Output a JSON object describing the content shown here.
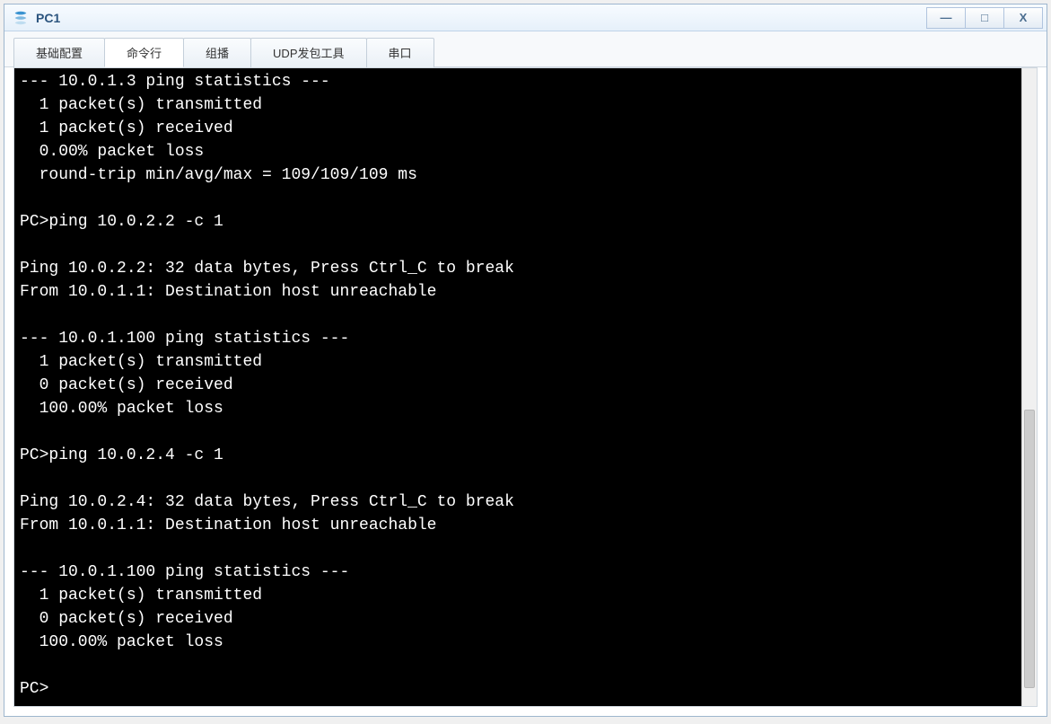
{
  "window": {
    "title": "PC1"
  },
  "titlebar_controls": {
    "minimize": "—",
    "maximize": "□",
    "close": "X"
  },
  "tabs": [
    {
      "label": "基础配置",
      "active": false
    },
    {
      "label": "命令行",
      "active": true
    },
    {
      "label": "组播",
      "active": false
    },
    {
      "label": "UDP发包工具",
      "active": false
    },
    {
      "label": "串口",
      "active": false
    }
  ],
  "terminal": {
    "lines": [
      "--- 10.0.1.3 ping statistics ---",
      "  1 packet(s) transmitted",
      "  1 packet(s) received",
      "  0.00% packet loss",
      "  round-trip min/avg/max = 109/109/109 ms",
      "",
      "PC>ping 10.0.2.2 -c 1",
      "",
      "Ping 10.0.2.2: 32 data bytes, Press Ctrl_C to break",
      "From 10.0.1.1: Destination host unreachable",
      "",
      "--- 10.0.1.100 ping statistics ---",
      "  1 packet(s) transmitted",
      "  0 packet(s) received",
      "  100.00% packet loss",
      "",
      "PC>ping 10.0.2.4 -c 1",
      "",
      "Ping 10.0.2.4: 32 data bytes, Press Ctrl_C to break",
      "From 10.0.1.1: Destination host unreachable",
      "",
      "--- 10.0.1.100 ping statistics ---",
      "  1 packet(s) transmitted",
      "  0 packet(s) received",
      "  100.00% packet loss",
      "",
      "PC>"
    ]
  }
}
